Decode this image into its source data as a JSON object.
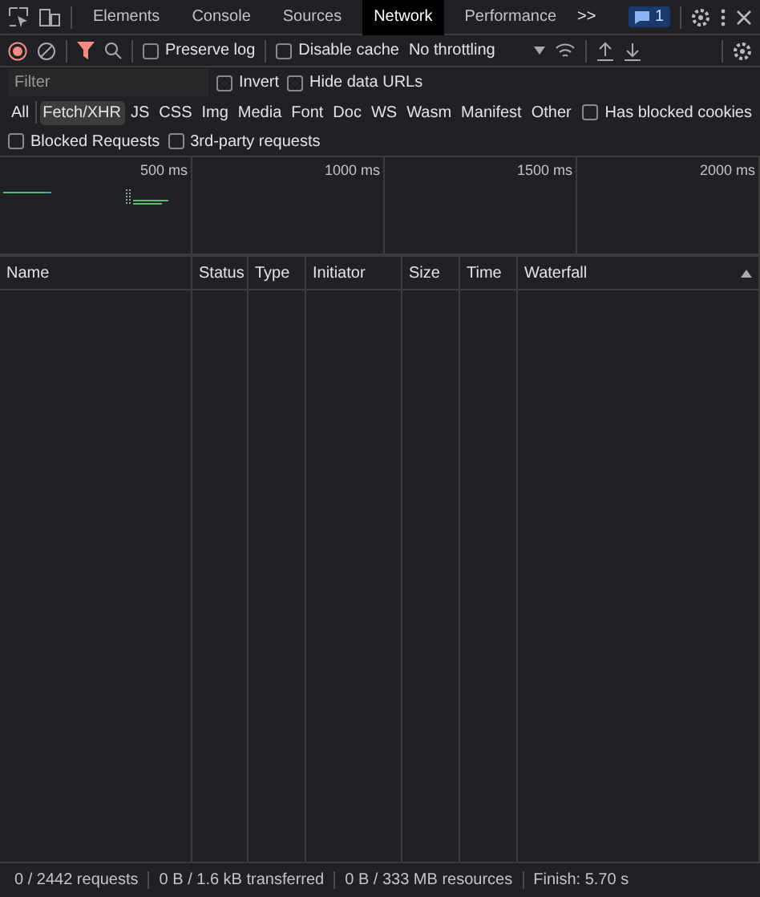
{
  "tabs": [
    {
      "label": "Elements",
      "selected": false
    },
    {
      "label": "Console",
      "selected": false
    },
    {
      "label": "Sources",
      "selected": false
    },
    {
      "label": "Network",
      "selected": true
    },
    {
      "label": "Performance",
      "selected": false
    }
  ],
  "more_tabs": ">>",
  "issues_badge": "1",
  "toolbar": {
    "recording": true,
    "preserve_log": {
      "label": "Preserve log",
      "checked": false
    },
    "disable_cache": {
      "label": "Disable cache",
      "checked": false
    },
    "throttling": "No throttling"
  },
  "filter": {
    "placeholder": "Filter",
    "invert": {
      "label": "Invert",
      "checked": false
    },
    "hide_data_urls": {
      "label": "Hide data URLs",
      "checked": false
    }
  },
  "type_filters": [
    {
      "label": "All",
      "selected": false
    },
    {
      "label": "Fetch/XHR",
      "selected": true
    },
    {
      "label": "JS",
      "selected": false
    },
    {
      "label": "CSS",
      "selected": false
    },
    {
      "label": "Img",
      "selected": false
    },
    {
      "label": "Media",
      "selected": false
    },
    {
      "label": "Font",
      "selected": false
    },
    {
      "label": "Doc",
      "selected": false
    },
    {
      "label": "WS",
      "selected": false
    },
    {
      "label": "Wasm",
      "selected": false
    },
    {
      "label": "Manifest",
      "selected": false
    },
    {
      "label": "Other",
      "selected": false
    }
  ],
  "has_blocked_cookies": {
    "label": "Has blocked cookies",
    "checked": false
  },
  "blocked_requests": {
    "label": "Blocked Requests",
    "checked": false
  },
  "third_party": {
    "label": "3rd-party requests",
    "checked": false
  },
  "overview_ticks": [
    "500 ms",
    "1000 ms",
    "1500 ms",
    "2000 ms"
  ],
  "table": {
    "columns": [
      "Name",
      "Status",
      "Type",
      "Initiator",
      "Size",
      "Time",
      "Waterfall"
    ]
  },
  "status_bar": [
    "0 / 2442 requests",
    "0 B / 1.6 kB transferred",
    "0 B / 333 MB resources",
    "Finish: 5.70 s"
  ]
}
